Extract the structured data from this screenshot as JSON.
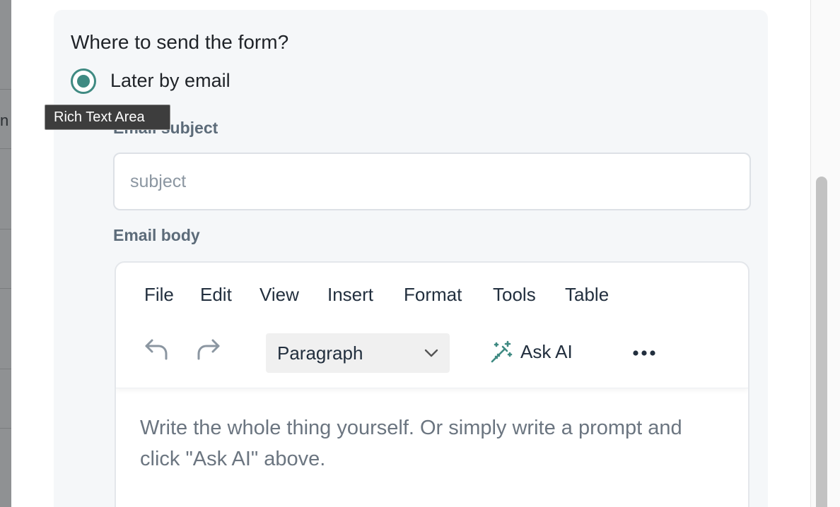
{
  "backdrop": {
    "fragment_text": "n"
  },
  "form": {
    "question": "Where to send the form?",
    "delivery_option": {
      "label": "Later by email",
      "selected": true
    },
    "tooltip": "Rich Text Area",
    "subject": {
      "label": "Email subject",
      "value": "",
      "placeholder": "subject"
    },
    "body": {
      "label": "Email body"
    }
  },
  "editor": {
    "menu": [
      "File",
      "Edit",
      "View",
      "Insert",
      "Format",
      "Tools",
      "Table"
    ],
    "toolbar": {
      "undo_icon": "undo-icon",
      "redo_icon": "redo-icon",
      "block_format": "Paragraph",
      "ask_ai_label": "Ask AI",
      "more_icon": "more-horizontal-icon"
    },
    "placeholder_text": "Write the whole thing yourself. Or simply write a prompt and click \"Ask AI\" above."
  },
  "colors": {
    "accent": "#3f8a82",
    "card_bg": "#f5f7f9",
    "label": "#5c6b79",
    "placeholder": "#6b7580"
  }
}
